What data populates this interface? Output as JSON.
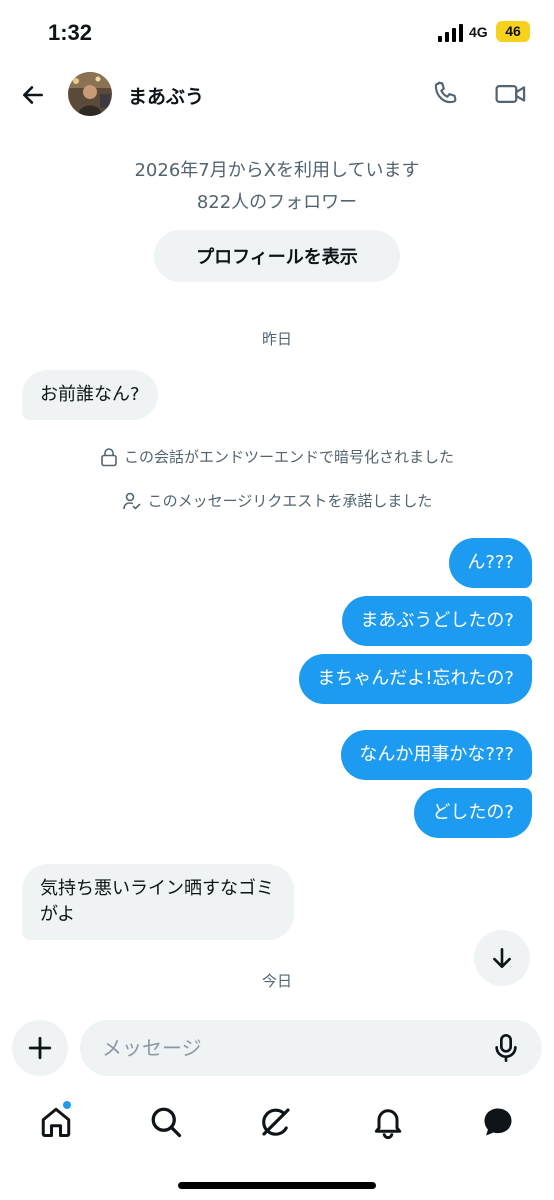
{
  "status_bar": {
    "time": "1:32",
    "network": "4G",
    "battery": "46"
  },
  "header": {
    "name": "まあぶう"
  },
  "profile_info": {
    "joined": "2026年7月からXを利用しています",
    "followers": "822人のフォロワー",
    "view_profile_label": "プロフィールを表示"
  },
  "messages": {
    "date_yesterday": "昨日",
    "incoming_1": "お前誰なん?",
    "system_encrypted": "この会話がエンドツーエンドで暗号化されました",
    "system_accepted": "このメッセージリクエストを承諾しました",
    "outgoing_1": "ん???",
    "outgoing_2": "まあぶうどしたの?",
    "outgoing_3": "まちゃんだよ!忘れたの?",
    "outgoing_4": "なんか用事かな???",
    "outgoing_5": "どしたの?",
    "incoming_2": "気持ち悪いライン晒すなゴミがよ",
    "date_today": "今日"
  },
  "composer": {
    "placeholder": "メッセージ"
  },
  "colors": {
    "accent": "#1d9bf0",
    "bubble_in": "#eff3f4",
    "battery": "#f7d21c",
    "muted_text": "#536471"
  },
  "icons": {
    "back": "arrow-left-icon",
    "call": "phone-icon",
    "video": "video-camera-icon",
    "lock": "lock-icon",
    "person_check": "person-check-icon",
    "scroll_down": "arrow-down-icon",
    "add": "plus-icon",
    "mic": "microphone-icon",
    "nav": [
      "home-icon",
      "search-icon",
      "grok-icon",
      "bell-icon",
      "messages-icon"
    ]
  }
}
